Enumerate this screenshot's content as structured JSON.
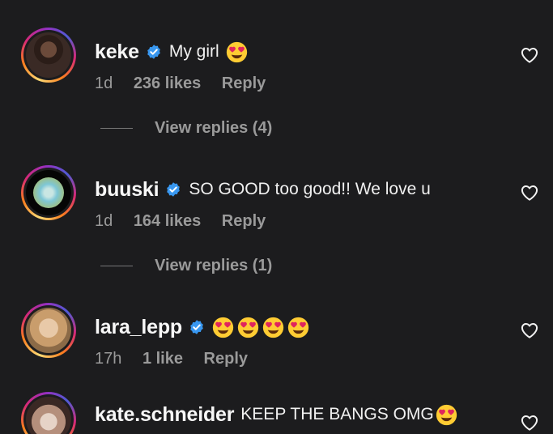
{
  "comments": [
    {
      "username": "keke",
      "text": "My girl",
      "emoji_count": 1,
      "emoji": "heart-eyes",
      "time": "1d",
      "likes": "236 likes",
      "reply": "Reply",
      "view_replies": "View replies (4)"
    },
    {
      "username": "buuski",
      "text": "SO GOOD too good!! We love u",
      "emoji_count": 0,
      "time": "1d",
      "likes": "164 likes",
      "reply": "Reply",
      "view_replies": "View replies (1)"
    },
    {
      "username": "lara_lepp",
      "text": "",
      "emoji_count": 4,
      "emoji": "heart-eyes",
      "time": "17h",
      "likes": "1 like",
      "reply": "Reply"
    },
    {
      "username": "kate.schneider",
      "text": "KEEP THE BANGS OMG",
      "emoji_count": 1,
      "emoji": "heart-eyes"
    }
  ],
  "colors": {
    "background": "#1c1c1e",
    "verified": "#3897f0",
    "muted": "#9a9a9a",
    "emoji": "#ffcc33"
  },
  "icons": {
    "verified": "verified-badge-icon",
    "like": "heart-outline-icon",
    "emoji": "heart-eyes-emoji-icon"
  }
}
